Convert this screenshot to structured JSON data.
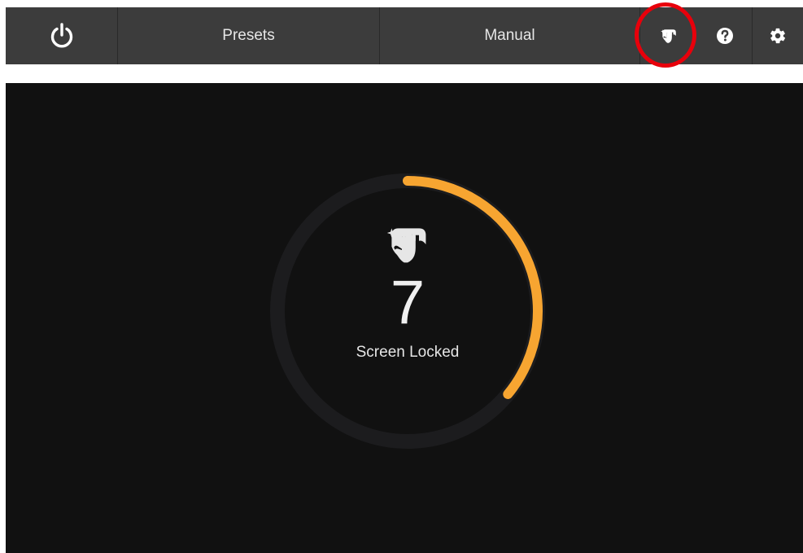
{
  "toolbar": {
    "power_icon": "power-icon",
    "presets_label": "Presets",
    "manual_label": "Manual",
    "clean_icon": "clean-screen-icon",
    "help_icon": "help-icon",
    "settings_icon": "gear-icon"
  },
  "lock": {
    "countdown": "7",
    "status_label": "Screen Locked",
    "progress_fraction": 0.36,
    "progress_color": "#f7a531",
    "track_color": "#1c1c1e"
  },
  "colors": {
    "toolbar_bg": "#3c3c3c",
    "panel_bg": "#111111",
    "highlight": "#e8000b"
  }
}
